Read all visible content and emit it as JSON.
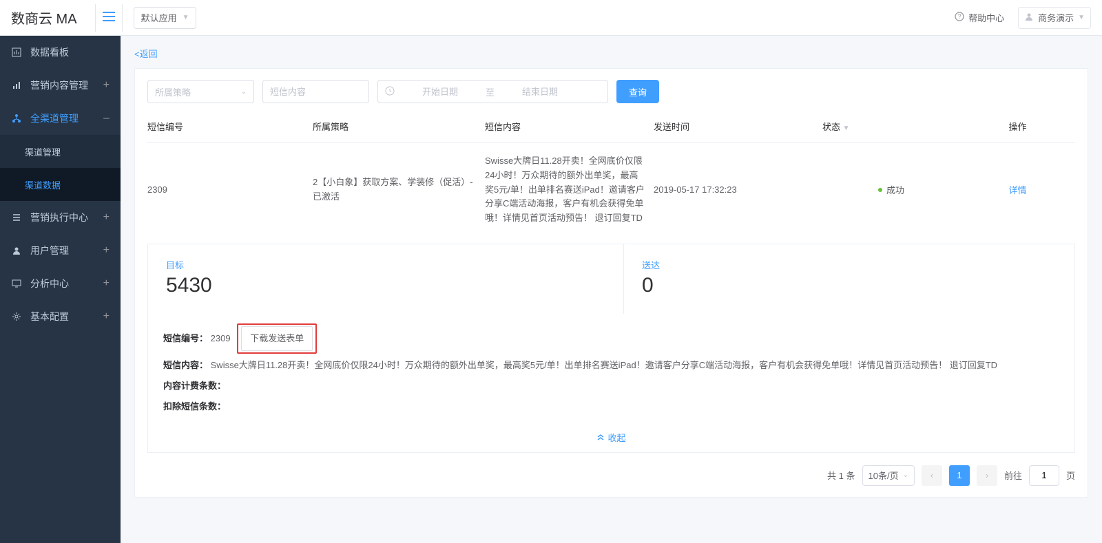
{
  "header": {
    "brand": "数商云 MA",
    "app_select": "默认应用",
    "help": "帮助中心",
    "user": "商务演示"
  },
  "sidebar": {
    "items": [
      {
        "label": "数据看板",
        "mark": ""
      },
      {
        "label": "营销内容管理",
        "mark": "+"
      },
      {
        "label": "全渠道管理",
        "mark": "–",
        "active": true,
        "children": [
          {
            "label": "渠道管理"
          },
          {
            "label": "渠道数据",
            "active": true
          }
        ]
      },
      {
        "label": "营销执行中心",
        "mark": "+"
      },
      {
        "label": "用户管理",
        "mark": "+"
      },
      {
        "label": "分析中心",
        "mark": "+"
      },
      {
        "label": "基本配置",
        "mark": "+"
      }
    ]
  },
  "back_link": "<返回",
  "filters": {
    "strategy_placeholder": "所属策略",
    "content_placeholder": "短信内容",
    "start_placeholder": "开始日期",
    "sep": "至",
    "end_placeholder": "结束日期",
    "query": "查询"
  },
  "table": {
    "headers": [
      "短信编号",
      "所属策略",
      "短信内容",
      "发送时间",
      "状态",
      "操作"
    ],
    "status_caret": "▼",
    "row": {
      "id": "2309",
      "strategy": "2【小白象】获取方案、学装修（促活）-已激活",
      "content": "Swisse大牌日11.28开卖！全网底价仅限24小时！万众期待的额外出单奖，最高奖5元/单！出单排名赛送iPad！邀请客户分享C端活动海报，客户有机会获得免单哦！详情见首页活动预告！ 退订回复TD",
      "time": "2019-05-17 17:32:23",
      "status": "成功",
      "op": "详情"
    }
  },
  "stats": {
    "target_label": "目标",
    "target_value": "5430",
    "delivered_label": "送达",
    "delivered_value": "0"
  },
  "detail": {
    "sms_id_label": "短信编号：",
    "sms_id_value": "2309",
    "download_btn": "下载发送表单",
    "content_label": "短信内容：",
    "content_value": "Swisse大牌日11.28开卖！全网底价仅限24小时！万众期待的额外出单奖，最高奖5元/单！出单排名赛送iPad！邀请客户分享C端活动海报，客户有机会获得免单哦！详情见首页活动预告！ 退订回复TD",
    "billing_label": "内容计费条数：",
    "billing_value": "",
    "deduct_label": "扣除短信条数：",
    "deduct_value": "",
    "collapse": "收起"
  },
  "pager": {
    "total": "共 1 条",
    "page_size": "10条/页",
    "current": "1",
    "goto_label": "前往",
    "goto_value": "1",
    "page_suffix": "页"
  }
}
